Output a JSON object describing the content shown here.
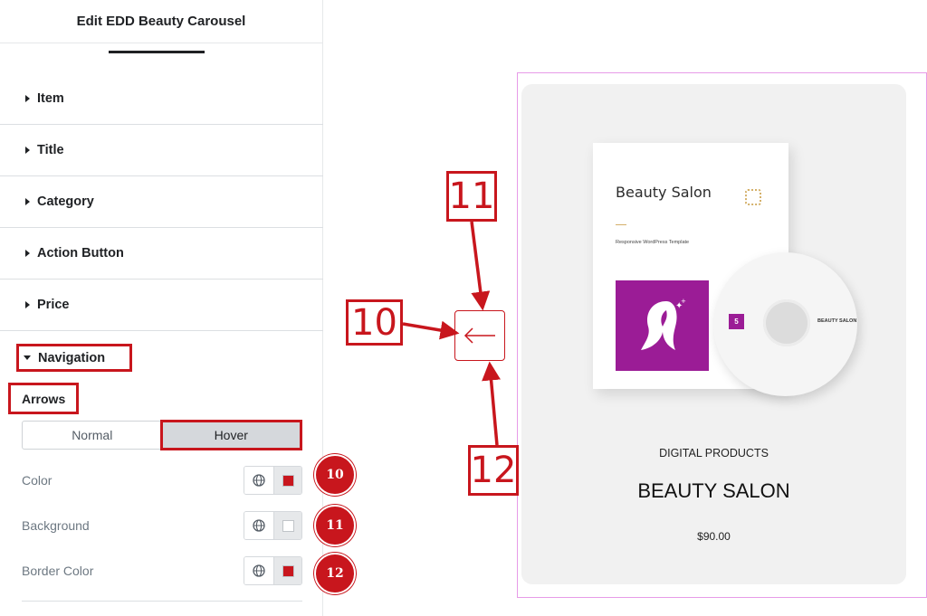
{
  "panel": {
    "title": "Edit EDD Beauty Carousel",
    "sections": [
      {
        "label": "Item"
      },
      {
        "label": "Title"
      },
      {
        "label": "Category"
      },
      {
        "label": "Action Button"
      },
      {
        "label": "Price"
      }
    ],
    "navigation": {
      "label": "Navigation",
      "subheading": "Arrows",
      "states": {
        "normal": "Normal",
        "hover": "Hover",
        "active": "hover"
      },
      "controls": [
        {
          "label": "Color",
          "swatch_color": "#c8161d",
          "badge": "10"
        },
        {
          "label": "Background",
          "swatch_color": "#ffffff",
          "badge": "11"
        },
        {
          "label": "Border Color",
          "swatch_color": "#c8161d",
          "badge": "12"
        }
      ]
    }
  },
  "callouts": {
    "left": "10",
    "top": "11",
    "bottom": "12"
  },
  "arrow_button": {
    "icon": "arrow-left-icon"
  },
  "product": {
    "mockup_title": "Beauty Salon",
    "mockup_subtitle": "Responsive WordPress Template",
    "cd_label": "BEAUTY SALON",
    "category": "DIGITAL PRODUCTS",
    "name": "BEAUTY SALON",
    "price": "$90.00"
  },
  "colors": {
    "accent_red": "#c8161d",
    "brand_purple": "#9b1c96",
    "preview_border": "#e79be8"
  }
}
